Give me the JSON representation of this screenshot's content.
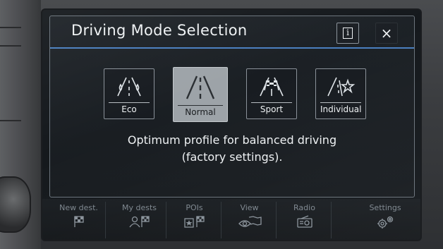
{
  "dialog": {
    "title": "Driving Mode Selection",
    "info_icon": "info-icon",
    "close_icon": "close-icon",
    "close_label": "×",
    "info_label": "i"
  },
  "modes": [
    {
      "label": "Eco",
      "icon": "eco-road-icon",
      "selected": false
    },
    {
      "label": "Normal",
      "icon": "road-icon",
      "selected": true
    },
    {
      "label": "Sport",
      "icon": "checkered-flag-road-icon",
      "selected": false
    },
    {
      "label": "Individual",
      "icon": "road-star-icon",
      "selected": false
    }
  ],
  "description": {
    "line1": "Optimum profile for balanced driving",
    "line2": "(factory settings)."
  },
  "navbar": [
    {
      "label": "New dest.",
      "icon": "checkered-flag-icon"
    },
    {
      "label": "My dests",
      "icon": "person-flag-icon"
    },
    {
      "label": "POIs",
      "icon": "poi-star-flag-icon"
    },
    {
      "label": "View",
      "icon": "map-eye-icon"
    },
    {
      "label": "Radio",
      "icon": "radio-icon"
    },
    {
      "label": "Settings",
      "icon": "gears-icon"
    }
  ],
  "colors": {
    "accent_line": "#4a7fc0",
    "selected_tile": "#9da3a8",
    "text": "#eef1f3",
    "nav_text": "#7e878f"
  }
}
